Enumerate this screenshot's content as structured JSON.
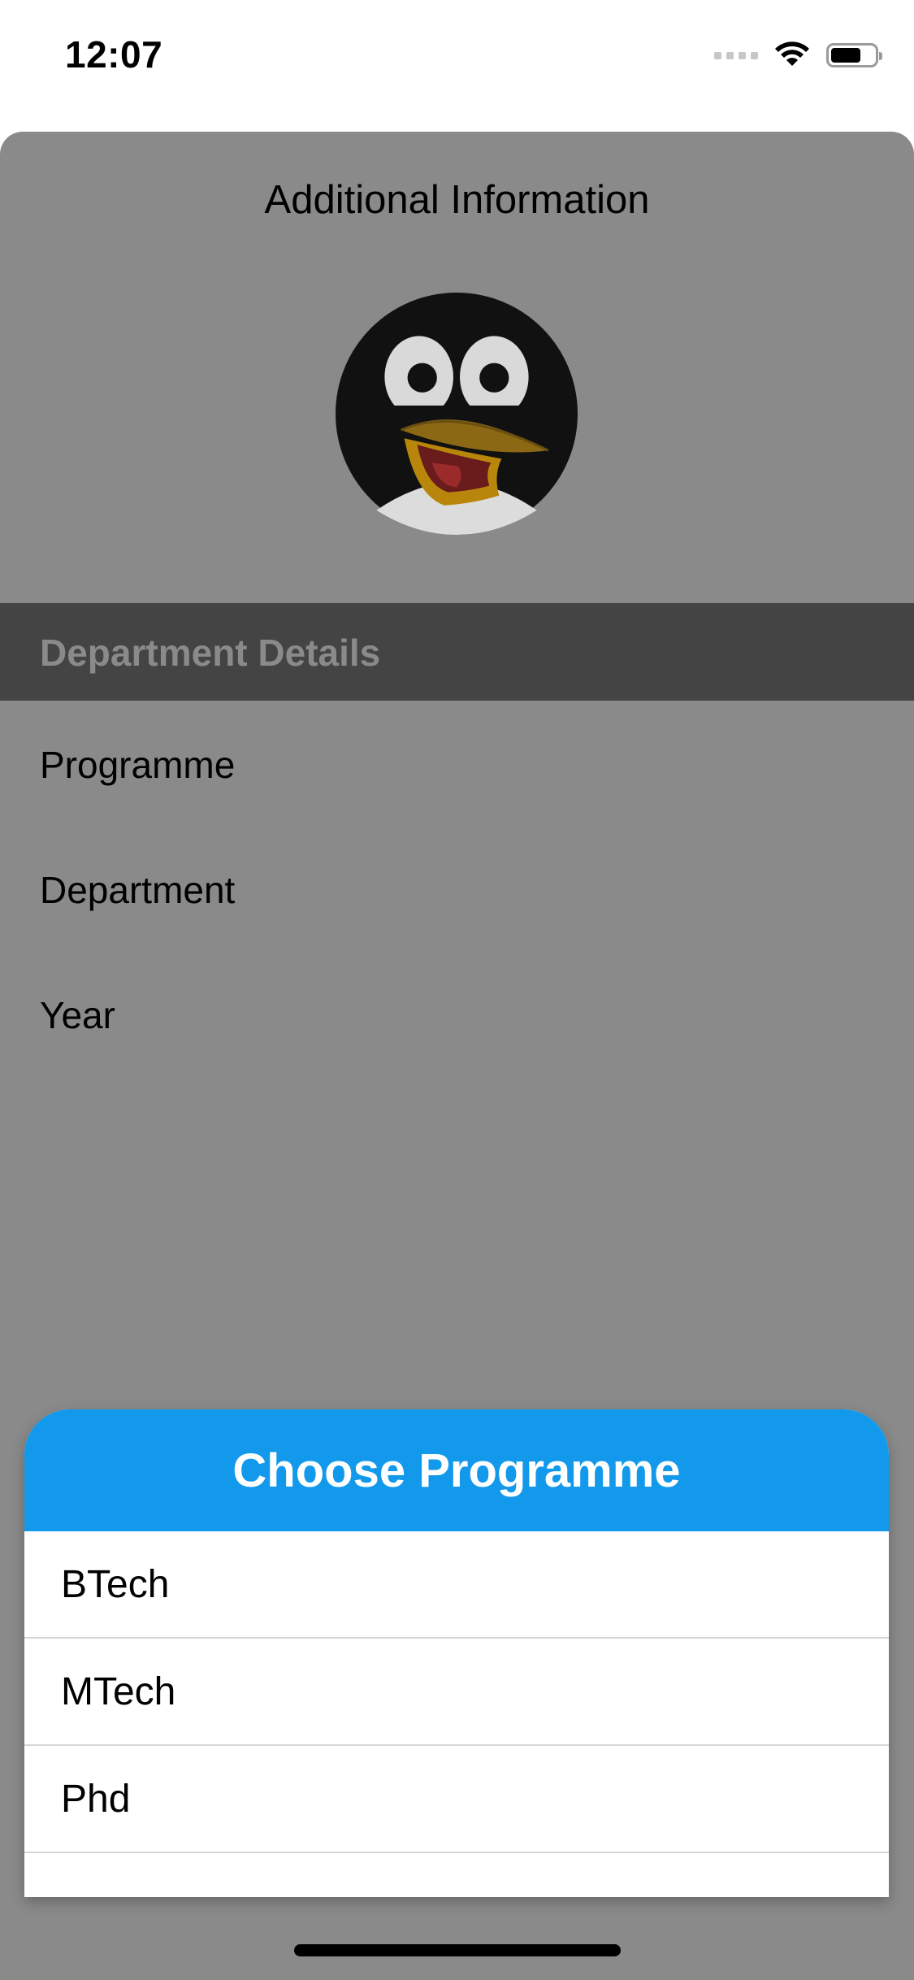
{
  "status_bar": {
    "time": "12:07",
    "battery_level": 0.7
  },
  "sheet": {
    "title": "Additional Information",
    "avatar_icon": "penguin-avatar-icon",
    "section_header": "Department Details",
    "fields": [
      "Programme",
      "Department",
      "Year"
    ],
    "background_color": "#8a8a8a",
    "section_header_color": "#444444"
  },
  "popup": {
    "title": "Choose Programme",
    "header_color": "#1299ec",
    "options": [
      "BTech",
      "MTech",
      "Phd"
    ]
  }
}
